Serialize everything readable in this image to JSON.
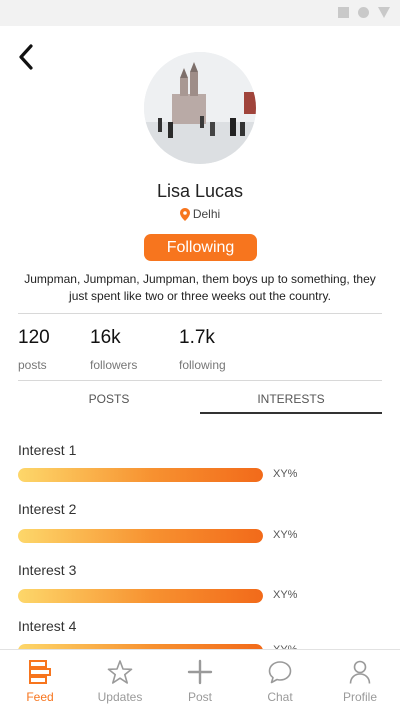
{
  "profile": {
    "name": "Lisa Lucas",
    "location": "Delhi",
    "follow_label": "Following",
    "bio": "Jumpman, Jumpman, Jumpman, them boys up to something, they just spent like two or three weeks out the country."
  },
  "stats": [
    {
      "value": "120",
      "label": "posts"
    },
    {
      "value": "16k",
      "label": "followers"
    },
    {
      "value": "1.7k",
      "label": "following"
    }
  ],
  "tabs": [
    {
      "label": "POSTS",
      "active": false
    },
    {
      "label": "INTERESTS",
      "active": true
    }
  ],
  "interests": [
    {
      "label": "Interest 1",
      "percent_text": "XY%"
    },
    {
      "label": "Interest 2",
      "percent_text": "XY%"
    },
    {
      "label": "Interest 3",
      "percent_text": "XY%"
    },
    {
      "label": "Interest 4",
      "percent_text": "XY%"
    }
  ],
  "nav": [
    {
      "label": "Feed",
      "icon": "feed-icon",
      "active": true
    },
    {
      "label": "Updates",
      "icon": "star-icon",
      "active": false
    },
    {
      "label": "Post",
      "icon": "plus-icon",
      "active": false
    },
    {
      "label": "Chat",
      "icon": "chat-bubble-icon",
      "active": false
    },
    {
      "label": "Profile",
      "icon": "person-icon",
      "active": false
    }
  ],
  "colors": {
    "accent": "#f7751e",
    "nav_inactive": "#9a9a9a",
    "bar_gradient_start": "#fdd76a",
    "bar_gradient_end": "#f26a1a"
  }
}
